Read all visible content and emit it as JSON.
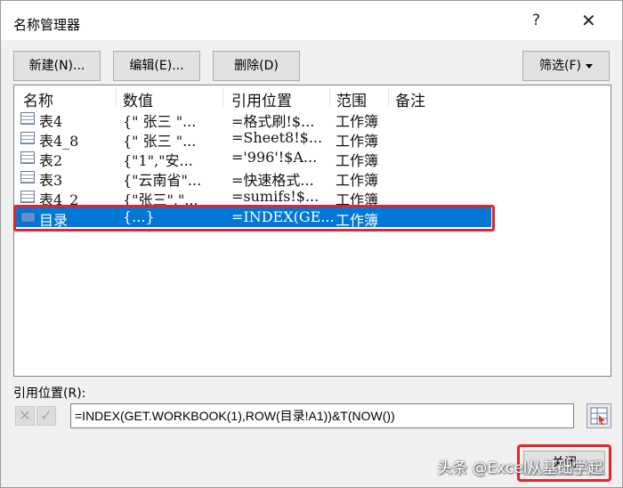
{
  "dialog": {
    "title": "名称管理器",
    "help": "?",
    "close": "✕"
  },
  "toolbar": {
    "new_label": "新建(N)...",
    "edit_label": "编辑(E)...",
    "delete_label": "删除(D)",
    "filter_label": "筛选(F)"
  },
  "list": {
    "columns": [
      "名称",
      "数值",
      "引用位置",
      "范围",
      "备注"
    ],
    "rows": [
      {
        "name": "表4",
        "value": "{\" 张三 \"...",
        "ref": "=格式刷!$...",
        "scope": "工作簿",
        "icon": "table-icon"
      },
      {
        "name": "表4_8",
        "value": "{\" 张三 \"...",
        "ref": "=Sheet8!$...",
        "scope": "工作簿",
        "icon": "table-icon"
      },
      {
        "name": "表2",
        "value": "{\"1\",\"安...",
        "ref": "='996'!$A...",
        "scope": "工作簿",
        "icon": "table-icon"
      },
      {
        "name": "表3",
        "value": "{\"云南省\"...",
        "ref": "=快速格式...",
        "scope": "工作簿",
        "icon": "table-icon"
      },
      {
        "name": "表4_2",
        "value": "{\"张三\",\"...",
        "ref": "=sumifs!$...",
        "scope": "工作簿",
        "icon": "table-icon"
      },
      {
        "name": "目录",
        "value": "{...}",
        "ref": "=INDEX(GE...",
        "scope": "工作簿",
        "icon": "defined-name-icon",
        "selected": true
      }
    ]
  },
  "reference": {
    "label": "引用位置(R):",
    "cancel_glyph": "✕",
    "ok_glyph": "✓",
    "value": "=INDEX(GET.WORKBOOK(1),ROW(目录!A1))&T(NOW())"
  },
  "footer": {
    "close_label": "关闭"
  },
  "watermark": "头条 @Excel从基础学起",
  "colors": {
    "selection": "#0078d7",
    "highlight": "#e3242b"
  }
}
